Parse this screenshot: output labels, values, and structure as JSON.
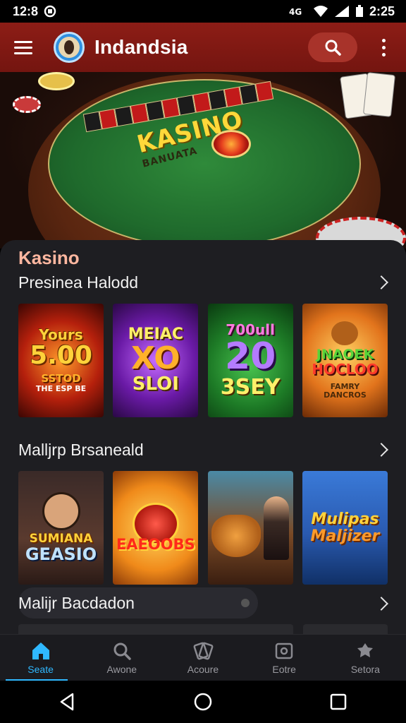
{
  "status_bar": {
    "time": "12:8",
    "battery_time": "2:25"
  },
  "app_bar": {
    "title": "Indandsia"
  },
  "hero": {
    "headline": "KASINO",
    "subline": "BANUATA"
  },
  "section": {
    "title": "Kasino"
  },
  "rows": [
    {
      "title": "Presinea Halodd",
      "tiles": [
        {
          "lines": [
            "Yours",
            "5.00",
            "SSTOD",
            "THE ESP BE"
          ]
        },
        {
          "lines": [
            "MEIAC",
            "XO",
            "SLOI"
          ]
        },
        {
          "lines": [
            "700ull",
            "20",
            "3SEY"
          ]
        },
        {
          "lines": [
            "JNAOEK",
            "HOCLOO",
            "FAMRY",
            "DANCROS"
          ]
        }
      ]
    },
    {
      "title": "Malljrp Brsaneald",
      "tiles": [
        {
          "lines": [
            "SUMIANA",
            "GEASIO"
          ]
        },
        {
          "lines": [
            "EAEOOBS"
          ]
        },
        {
          "lines": []
        },
        {
          "lines": [
            "Mulipas",
            "Maljizer"
          ]
        }
      ]
    },
    {
      "title": "Malijr Bacdadon"
    }
  ],
  "bottom_nav": [
    {
      "label": "Seate",
      "icon": "home-icon",
      "active": true
    },
    {
      "label": "Awone",
      "icon": "search-icon",
      "active": false
    },
    {
      "label": "Acoure",
      "icon": "cards-icon",
      "active": false
    },
    {
      "label": "Eotre",
      "icon": "wallet-icon",
      "active": false
    },
    {
      "label": "Setora",
      "icon": "settings-icon",
      "active": false
    }
  ],
  "colors": {
    "app_bar": "#8d1d16",
    "accent": "#2fb8ff",
    "panel": "#1e1e22",
    "section_title": "#ffb7a0"
  }
}
